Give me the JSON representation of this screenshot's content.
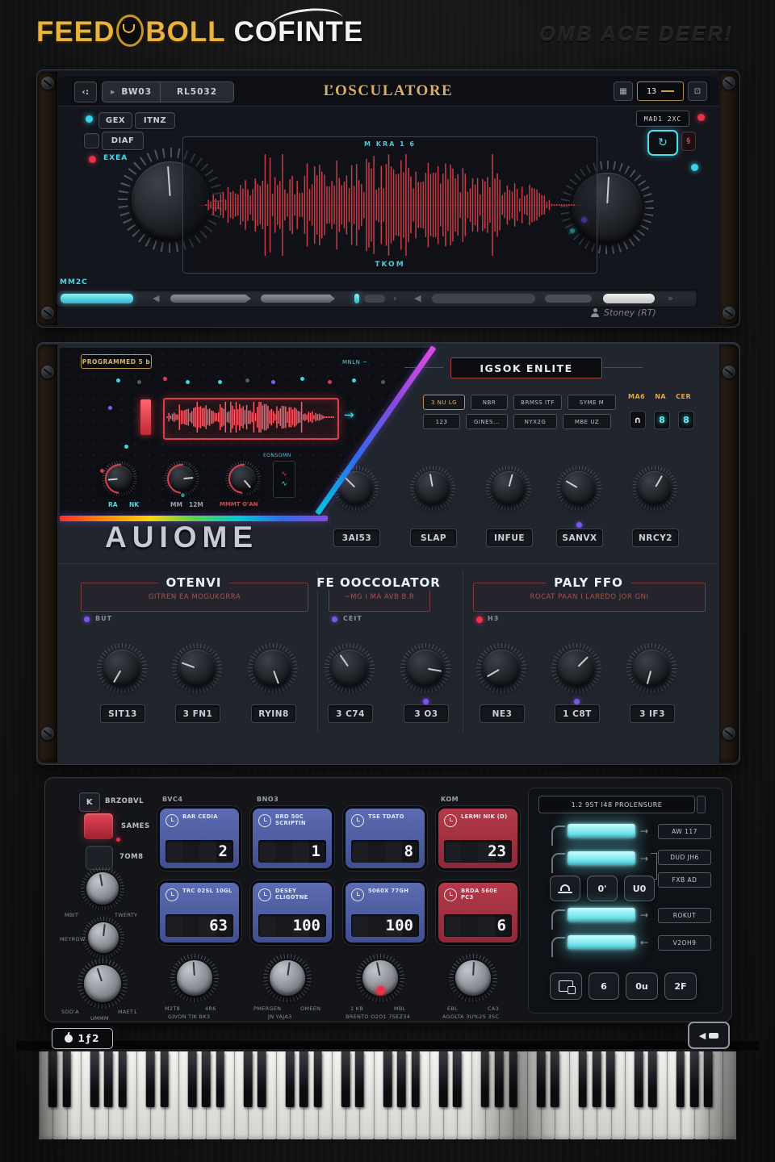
{
  "icons": {
    "back_colon": "‹:",
    "play": "▶",
    "grid": "▦",
    "page": "⊡",
    "loop": "↻",
    "squiggle": "§",
    "seg_left": "◀",
    "seg_right": "›",
    "seg_skip": "»",
    "arrow_right": "→",
    "arrow_left": "←",
    "back": "◀",
    "wave_meter_a": "∿",
    "wave_meter_b": "∿"
  },
  "colors": {
    "gold": "#d9a84e",
    "cyan": "#43dcea",
    "red": "#d83a48",
    "purple": "#7a55f0",
    "blue_box": "#4f5da0",
    "red_box": "#a62b3c",
    "bar_glow": "#8ef2f4"
  },
  "header": {
    "logo_a": "FEED",
    "logo_b": "BOLL",
    "logo_c": "COFINTE",
    "tagline": "OMB ACE DEER!"
  },
  "panel1": {
    "preset_a": "BW03",
    "preset_b": "RL5032",
    "title": "ĽOSCULATORE",
    "counter": "13",
    "btn1": "GEX",
    "btn2": "ITNZ",
    "btn3": "DIAF",
    "led_label": "EXEA",
    "mini_display": "MAD1 2XC",
    "wave_top": "M KRA 1 6",
    "wave_bottom": "TKOM",
    "scrub_label": "MM2C",
    "credit": "Stoney (RT)"
  },
  "panel2": {
    "program_chip": "PROGRAMMED 5 b",
    "corner_label": "MNLN ~",
    "mini_labels": [
      "RA",
      "NK",
      "MM",
      "12M",
      "MMMT O'AN"
    ],
    "meter_label": "EONSOMN",
    "big_name": "AUIOME",
    "right_title": "IGSOK ENLITE",
    "chips1": [
      "3 NU LG",
      "NBR",
      "BRMSS ITF",
      "SYME M"
    ],
    "chips2": [
      "123",
      "GINES...",
      "NYX2G",
      "MBE UZ"
    ],
    "gold_labels": [
      "MA6",
      "NA",
      "CER"
    ],
    "locks": [
      "∩",
      "8",
      "8"
    ],
    "knob_labels": [
      "3AI53",
      "SLAP",
      "INFUE",
      "SANVX",
      "NRCY2"
    ],
    "sections": [
      {
        "title": "OTENVI",
        "subtitle": "GITREN  EA  MOGUKGRRA",
        "led": "BUT"
      },
      {
        "title": "FE OOCCOLATOR",
        "subtitle": "~MG I MA AVB B.R",
        "led": "CEIT"
      },
      {
        "title": "PALY FFO",
        "subtitle": "ROCAT PAAN I LAREDO JOR GNI",
        "led": "H3"
      }
    ],
    "bottom_labels": [
      "SIT13",
      "3 FN1",
      "RYIN8",
      "3 C74",
      "3 O3",
      "NE3",
      "1 C8T",
      "3 IF3"
    ]
  },
  "panel3": {
    "mode_btn": "K",
    "mode_label": "BRZOBVL",
    "toggle_on_label": "SAMES",
    "toggle_off_label": "7OM8",
    "left_k1a": "MBIT",
    "left_k1b": "TWERTY",
    "left_k2": "MEYROW",
    "headers": [
      "BVC4",
      "BNO3",
      "KOM"
    ],
    "boxes": [
      {
        "title": "BAR CEDIA",
        "value": "2"
      },
      {
        "title": "BRD 50C SCRIPTIN",
        "value": "1"
      },
      {
        "title": "TSE TDATO",
        "value": "8"
      },
      {
        "title": "LERMI NIK (D)",
        "value": "23"
      },
      {
        "title": "TRC 02SL 10GL",
        "value": "63"
      },
      {
        "title": "DESEY CLIGOTNE",
        "value": "100"
      },
      {
        "title": "5060X 77GH",
        "value": "100"
      },
      {
        "title": "BRDA 560E PC3",
        "value": "6"
      }
    ],
    "knobs": [
      {
        "tl": "SOD'A",
        "tr": "MAET1",
        "bot": "UMMM"
      },
      {
        "tl": "M2T8",
        "tr": "4R6",
        "bot": "GIVON TIK BK3"
      },
      {
        "tl": "PMERGEN",
        "tr": "OMEEN",
        "bot": "JN YAJA3"
      },
      {
        "tl": "1 KB",
        "tr": "MBL",
        "bot": "BRENTO O2O1 7SEZ34"
      },
      {
        "tl": "EBL",
        "tr": "CA3",
        "bot": "AGOLTA 3U%2S 3SC"
      }
    ],
    "flow": {
      "title": "1.2  95T I48 PROLENSURE",
      "labels": [
        "AW 117",
        "DUD JH6",
        "FXB AD",
        "ROKUT",
        "V2OH9"
      ],
      "btn_a": "0'",
      "btn_b": "U0",
      "btn_c": "6",
      "btn_d": "0u",
      "btn_e": "2F"
    },
    "page_chip": "1ƒ2"
  }
}
